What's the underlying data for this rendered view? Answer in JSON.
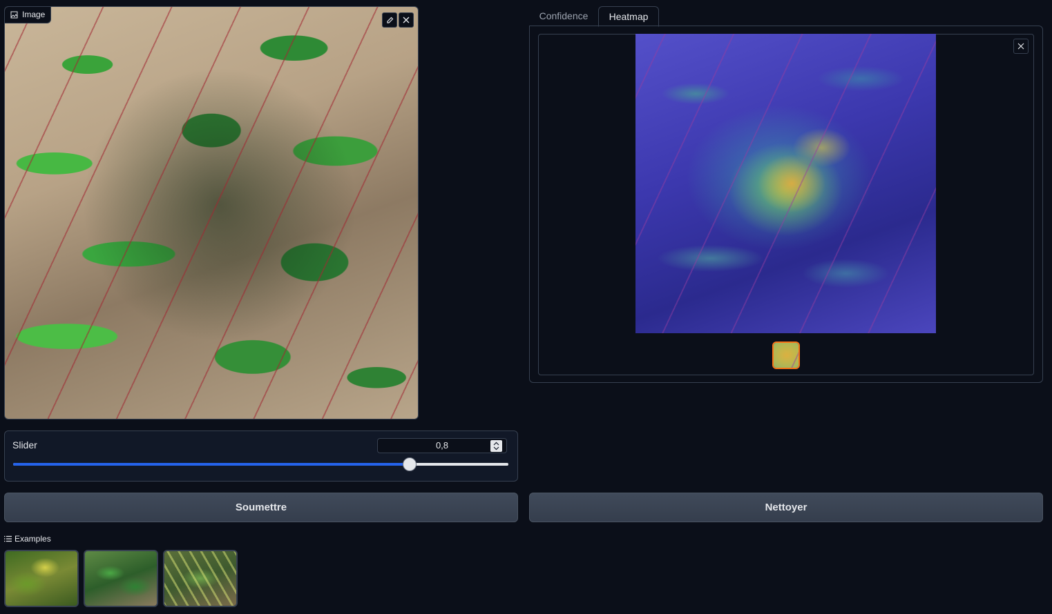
{
  "input_image": {
    "label": "Image",
    "icons": [
      "image-icon",
      "edit-icon",
      "close-icon"
    ]
  },
  "tabs": [
    {
      "label": "Confidence",
      "active": false
    },
    {
      "label": "Heatmap",
      "active": true
    }
  ],
  "output_gallery": {
    "icons": [
      "close-icon"
    ],
    "selected_thumbnail_index": 0,
    "thumbnail_count": 1
  },
  "slider": {
    "label": "Slider",
    "value": "0,8",
    "fraction": 0.8
  },
  "buttons": {
    "submit": "Soumettre",
    "clear": "Nettoyer"
  },
  "examples": {
    "label": "Examples",
    "count": 3
  },
  "colors": {
    "background": "#0b0f19",
    "border": "#374151",
    "slider_fill": "#2563eb",
    "selected_thumb_border": "#f97316",
    "button_bg": "#374151"
  }
}
